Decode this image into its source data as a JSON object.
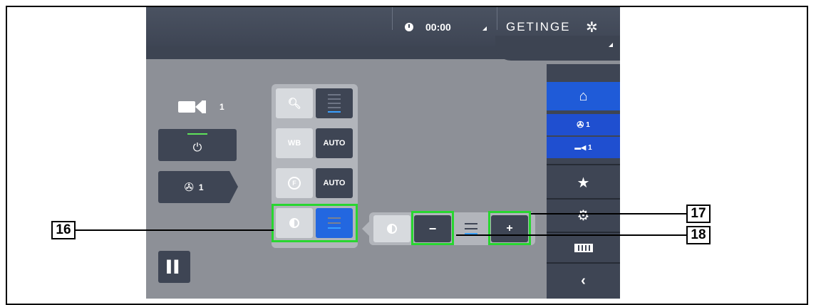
{
  "header": {
    "time": "00:00",
    "brand": "GETINGE"
  },
  "left_panel": {
    "camera_number": "1",
    "lighthead_number": "1"
  },
  "controls": {
    "white_balance_label": "WB",
    "white_balance_value": "AUTO",
    "focus_value": "AUTO"
  },
  "expand_panel": {
    "minus_label": "−",
    "plus_label": "+"
  },
  "sidebar": {
    "lighthead_item": "1",
    "camera_item": "1"
  },
  "callouts": {
    "c16": "16",
    "c17": "17",
    "c18": "18"
  },
  "colors": {
    "accent_blue": "#2367e0",
    "highlight_green": "#28d630",
    "dark_panel": "#3e4554"
  }
}
